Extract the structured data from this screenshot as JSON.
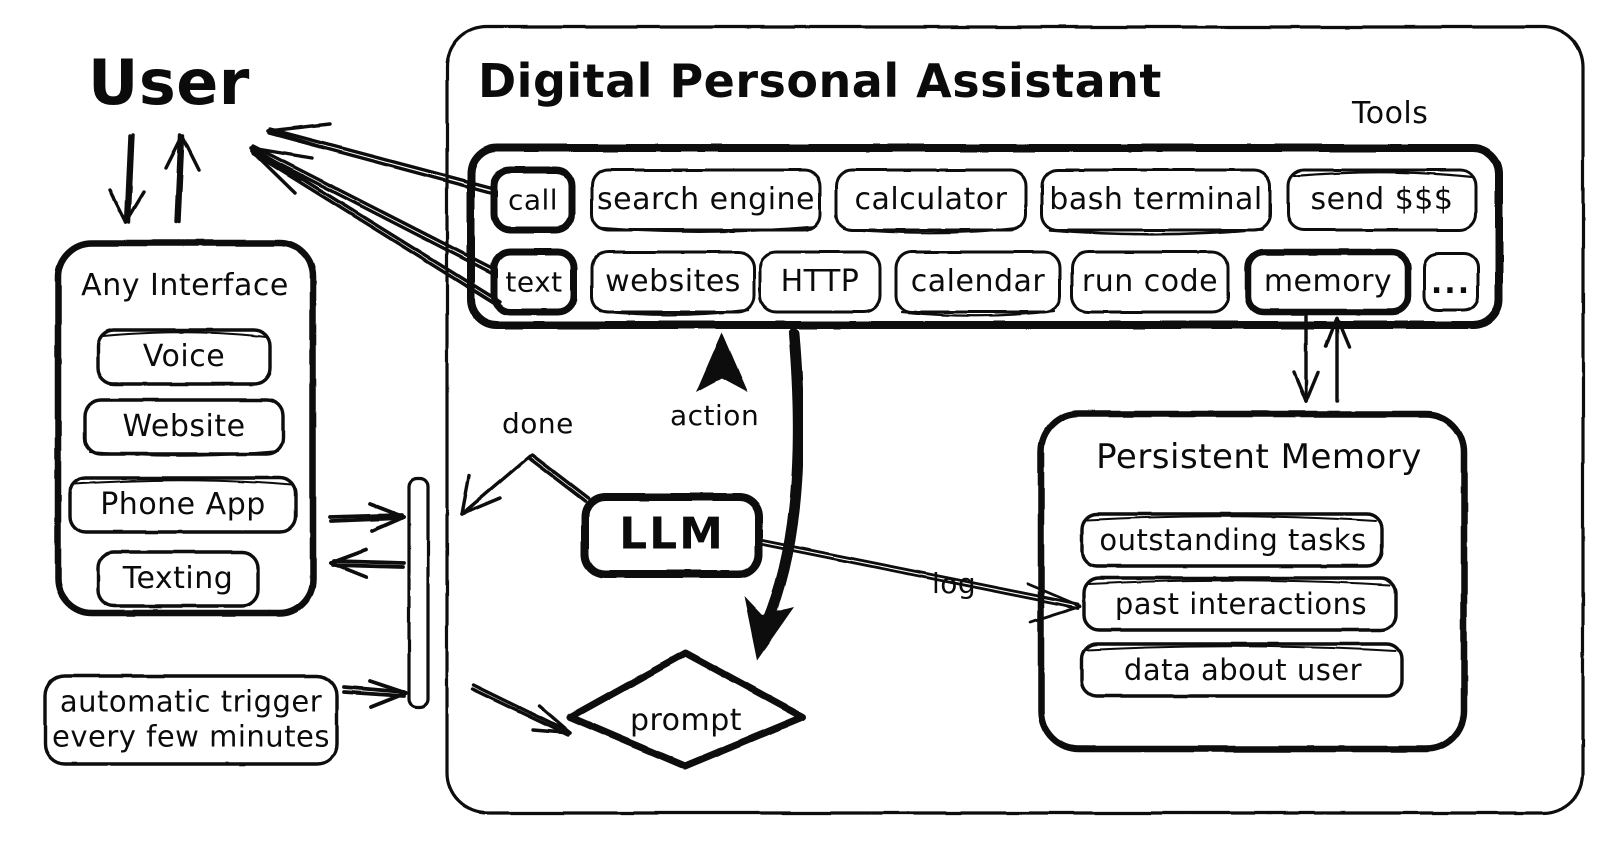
{
  "diagram": {
    "type": "architecture-flow-diagram",
    "actor": {
      "label": "User"
    },
    "assistant_panel": {
      "title": "Digital Personal Assistant",
      "tools_group": {
        "label": "Tools",
        "rows": [
          [
            {
              "label": "call",
              "emphasis": "bold"
            },
            {
              "label": "search engine",
              "emphasis": "normal"
            },
            {
              "label": "calculator",
              "emphasis": "normal"
            },
            {
              "label": "bash terminal",
              "emphasis": "normal"
            },
            {
              "label": "send $$$",
              "emphasis": "normal"
            }
          ],
          [
            {
              "label": "text",
              "emphasis": "bold"
            },
            {
              "label": "websites",
              "emphasis": "normal"
            },
            {
              "label": "HTTP",
              "emphasis": "normal"
            },
            {
              "label": "calendar",
              "emphasis": "normal"
            },
            {
              "label": "run code",
              "emphasis": "normal"
            },
            {
              "label": "memory",
              "emphasis": "bold"
            },
            {
              "label": "...",
              "emphasis": "normal"
            }
          ]
        ]
      },
      "core": {
        "llm": {
          "label": "LLM"
        },
        "prompt": {
          "label": "prompt"
        }
      },
      "memory_panel": {
        "title": "Persistent Memory",
        "items": [
          {
            "label": "outstanding tasks"
          },
          {
            "label": "past interactions"
          },
          {
            "label": "data about user"
          }
        ]
      }
    },
    "interface_panel": {
      "title": "Any Interface",
      "items": [
        {
          "label": "Voice"
        },
        {
          "label": "Website"
        },
        {
          "label": "Phone App"
        },
        {
          "label": "Texting"
        }
      ]
    },
    "trigger": {
      "label": "automatic trigger\never y few minutes",
      "text": "automatic trigger\nevery few minutes"
    },
    "edge_labels": {
      "done": "done",
      "action": "action",
      "log": "log"
    },
    "colors": {
      "ink": "#0b0b0b",
      "background": "#ffffff"
    }
  }
}
